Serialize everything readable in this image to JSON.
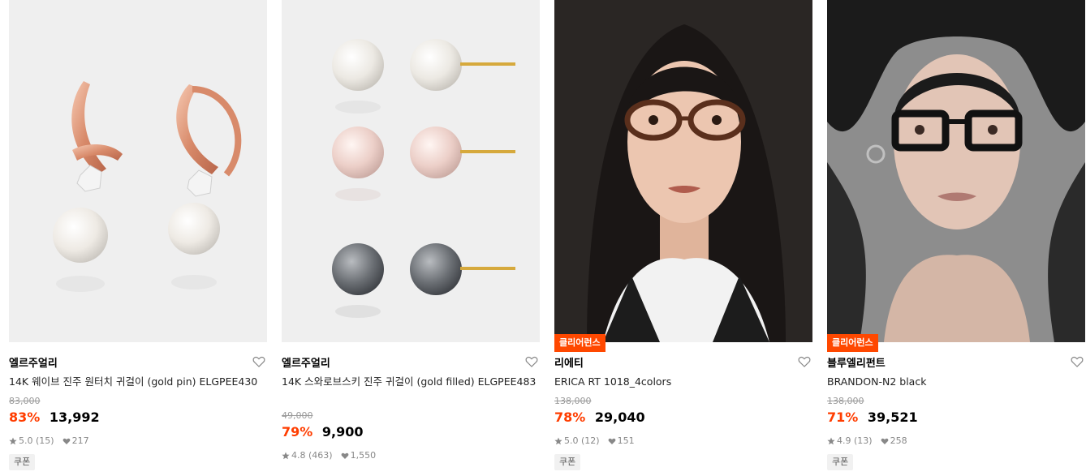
{
  "colors": {
    "accent": "#ff3d00",
    "tag_bg": "#ff4800"
  },
  "products": [
    {
      "brand": "엘르주얼리",
      "name": "14K 웨이브 진주 원터치 귀걸이 (gold pin) ELGPEE430",
      "original_price": "83,000",
      "discount": "83%",
      "price": "13,992",
      "rating": "5.0",
      "reviews": "(15)",
      "likes": "217",
      "coupon": "쿠폰",
      "tag": ""
    },
    {
      "brand": "엘르주얼리",
      "name": "14K 스와로브스키 진주 귀걸이 (gold filled) ELGPEE483",
      "original_price": "49,000",
      "discount": "79%",
      "price": "9,900",
      "rating": "4.8",
      "reviews": "(463)",
      "likes": "1,550",
      "coupon": "",
      "tag": ""
    },
    {
      "brand": "리에티",
      "name": "ERICA RT 1018_4colors",
      "original_price": "138,000",
      "discount": "78%",
      "price": "29,040",
      "rating": "5.0",
      "reviews": "(12)",
      "likes": "151",
      "coupon": "쿠폰",
      "tag": "클리어런스"
    },
    {
      "brand": "블루엘리펀트",
      "name": "BRANDON-N2 black",
      "original_price": "138,000",
      "discount": "71%",
      "price": "39,521",
      "rating": "4.9",
      "reviews": "(13)",
      "likes": "258",
      "coupon": "쿠폰",
      "tag": "클리어런스"
    }
  ]
}
